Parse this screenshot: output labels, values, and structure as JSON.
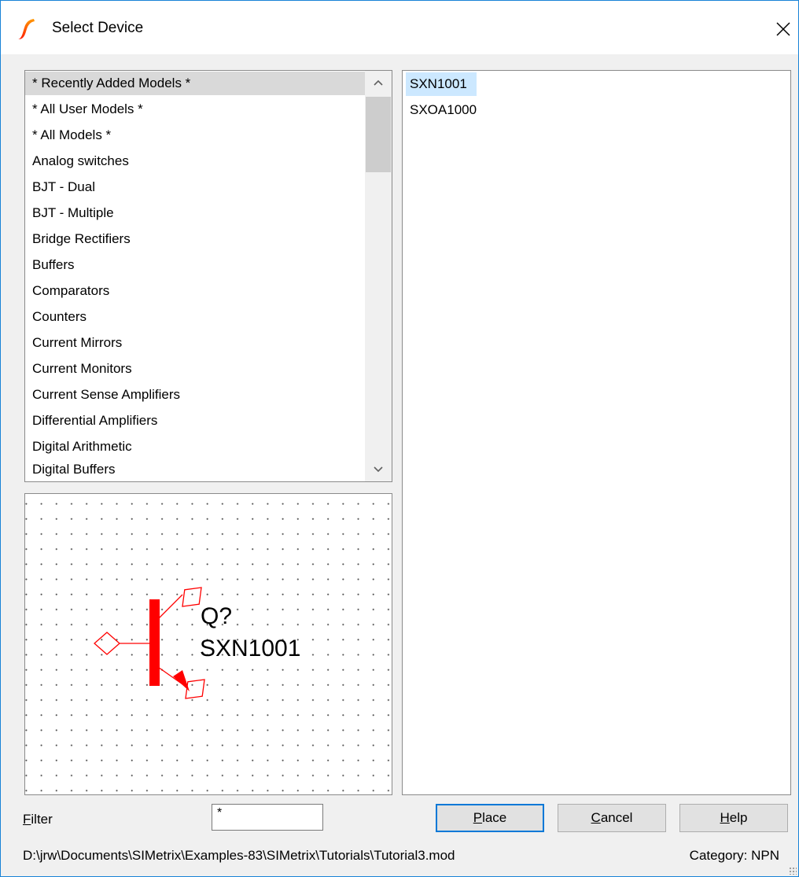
{
  "window": {
    "title": "Select Device"
  },
  "categories": [
    "* Recently Added Models *",
    "* All User Models *",
    "* All Models *",
    "Analog switches",
    "BJT - Dual",
    "BJT - Multiple",
    "Bridge Rectifiers",
    "Buffers",
    "Comparators",
    "Counters",
    "Current Mirrors",
    "Current Monitors",
    "Current Sense Amplifiers",
    "Differential Amplifiers",
    "Digital Arithmetic",
    "Digital Buffers"
  ],
  "selected_category": "* Recently Added Models *",
  "devices": [
    "SXN1001",
    "SXOA1000"
  ],
  "selected_device": "SXN1001",
  "preview": {
    "ref": "Q?",
    "model": "SXN1001",
    "symbol_color": "#ff0000"
  },
  "filter": {
    "label_prefix": "F",
    "label_rest": "ilter",
    "value": "*"
  },
  "buttons": {
    "place_prefix": "P",
    "place_rest": "lace",
    "cancel_prefix": "C",
    "cancel_rest": "ancel",
    "help_prefix": "H",
    "help_rest": "elp"
  },
  "status": {
    "path": "D:\\jrw\\Documents\\SIMetrix\\Examples-83\\SIMetrix\\Tutorials\\Tutorial3.mod",
    "category": "Category: NPN"
  },
  "icons": {
    "app": "simetrix-logo-icon",
    "close": "close-icon",
    "scroll_up": "chevron-up-icon",
    "scroll_down": "chevron-down-icon"
  },
  "colors": {
    "accent": "#0078d7",
    "selection_list": "#d9d9d9",
    "selection_device": "#cce8ff"
  }
}
